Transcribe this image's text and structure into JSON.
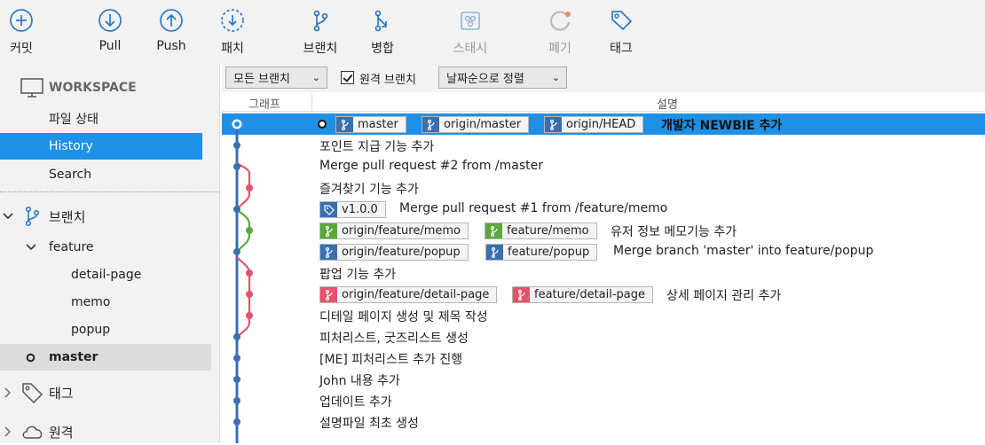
{
  "toolbar": {
    "commit": "커밋",
    "pull": "Pull",
    "push": "Push",
    "patch": "패치",
    "branch": "브랜치",
    "merge": "병합",
    "stash": "스태시",
    "discard": "폐기",
    "tag": "태그"
  },
  "sidebar": {
    "workspace": "WORKSPACE",
    "file_status": "파일 상태",
    "history": "History",
    "search": "Search",
    "branches": "브랜치",
    "feature": "feature",
    "detail_page": "detail-page",
    "memo": "memo",
    "popup": "popup",
    "master": "master",
    "tags": "태그",
    "remotes": "원격"
  },
  "filter": {
    "all_branches": "모든 브랜치",
    "remote_branches": "원격 브랜치",
    "sort": "날짜순으로 정렬"
  },
  "columns": {
    "graph": "그래프",
    "description": "설명"
  },
  "commits": [
    {
      "tags": [
        "master",
        "origin/master",
        "origin/HEAD"
      ],
      "message": "개발자 NEWBIE 추가"
    },
    {
      "tags": [],
      "message": "포인트 지급 기능 추가"
    },
    {
      "tags": [],
      "message": "Merge pull request #2 from                        /master"
    },
    {
      "tags": [],
      "message": "즐겨찾기 기능 추가"
    },
    {
      "tags": [
        "v1.0.0"
      ],
      "message": "Merge pull request #1 from                        /feature/memo"
    },
    {
      "tags": [
        "origin/feature/memo",
        "feature/memo"
      ],
      "message": "유저 정보 메모기능 추가"
    },
    {
      "tags": [
        "origin/feature/popup",
        "feature/popup"
      ],
      "message": "Merge branch 'master' into feature/popup"
    },
    {
      "tags": [],
      "message": "팝업 기능 추가"
    },
    {
      "tags": [
        "origin/feature/detail-page",
        "feature/detail-page"
      ],
      "message": "상세 페이지 관리 추가"
    },
    {
      "tags": [],
      "message": "디테일 페이지 생성 및 제목 작성"
    },
    {
      "tags": [],
      "message": "피처리스트, 굿즈리스트 생성"
    },
    {
      "tags": [],
      "message": "[ME] 피처리스트 추가 진행"
    },
    {
      "tags": [],
      "message": "John 내용 추가"
    },
    {
      "tags": [],
      "message": "업데이트 추가"
    },
    {
      "tags": [],
      "message": "설명파일 최초 생성"
    }
  ],
  "colors": {
    "accent": "#1e90e6",
    "blue_lane": "#3a6fb0",
    "red_lane": "#e5536a",
    "green_lane": "#5aa83c"
  }
}
